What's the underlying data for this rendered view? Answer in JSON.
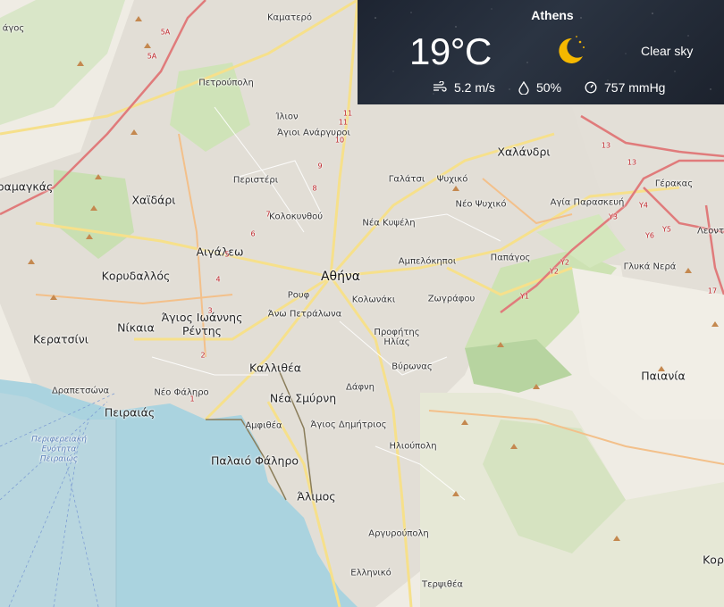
{
  "weather": {
    "city": "Athens",
    "temperature": "19°C",
    "condition": "Clear sky",
    "condition_icon": "moon-clear-night-icon",
    "wind": "5.2 m/s",
    "humidity": "50%",
    "pressure": "757 mmHg"
  },
  "map": {
    "places": {
      "kamatero": "Καματερό",
      "petroupoli": "Πετρούπολη",
      "ilion": "Ίλιον",
      "agioi_anargyroi": "Άγιοι Ανάργυροι",
      "peristeri": "Περιστέρι",
      "kolokynthou": "Κολοκυνθού",
      "galatsi": "Γαλάτσι",
      "psychiko": "Ψυχικό",
      "chalandri": "Χαλάνδρι",
      "gerakas": "Γέρακας",
      "neo_psychiko": "Νέο Ψυχικό",
      "agia_paraskevi": "Αγία Παρασκευή",
      "nea_kifisia": "Νέα Κυψέλη",
      "aspropyrgos": "ραμαγκάς",
      "chaidari": "Χαϊδάρι",
      "aigaleo": "Αιγάλεω",
      "korydallos": "Κορυδαλλός",
      "athina": "Αθήνα",
      "ampelokipoi": "Αμπελόκηποι",
      "papagos": "Παπάγος",
      "glyka_nera": "Γλυκά Νερά",
      "leontari": "Λεοντ",
      "rouf": "Ρουφ",
      "kolonaki": "Κολωνάκι",
      "zografou": "Ζωγράφου",
      "ano_petralona": "Άνω Πετράλωνα",
      "nikaia": "Νίκαια",
      "agios_ioannis_rentis": "Άγιος Ιωάννης\nΡέντης",
      "keratsini": "Κερατσίνι",
      "profitis_ilias": "Προφήτης\nΗλίας",
      "kallithea": "Καλλιθέα",
      "vyronas": "Βύρωνας",
      "paiania": "Παιανία",
      "drapetsona": "Δραπετσώνα",
      "neo_faliro": "Νέο Φάληρο",
      "peiraias": "Πειραιάς",
      "nea_smyrni": "Νέα Σμύρνη",
      "dafni": "Δάφνη",
      "amfithea": "Αμφιθέα",
      "agios_dimitrios": "Άγιος Δημήτριος",
      "ilioupoli": "Ηλιούπολη",
      "paleo_faliro": "Παλαιό Φάληρο",
      "alimos": "Άλιμος",
      "argyroupoli": "Αργυρούπολη",
      "elliniko": "Ελληνικό",
      "terpsithea": "Τερψιθέα",
      "koro": "Κορ",
      "agos": "άγος",
      "piraeus_region": "Περιφερειακή\nΕνότητα\nΠειραιώς"
    },
    "routes": [
      "5A",
      "5A",
      "11",
      "11",
      "10",
      "9",
      "8",
      "7",
      "6",
      "5",
      "4",
      "3",
      "2",
      "1",
      "13",
      "13",
      "Y3",
      "Y4",
      "Y5",
      "Y6",
      "Y2",
      "Y2",
      "Y1",
      "17"
    ]
  }
}
